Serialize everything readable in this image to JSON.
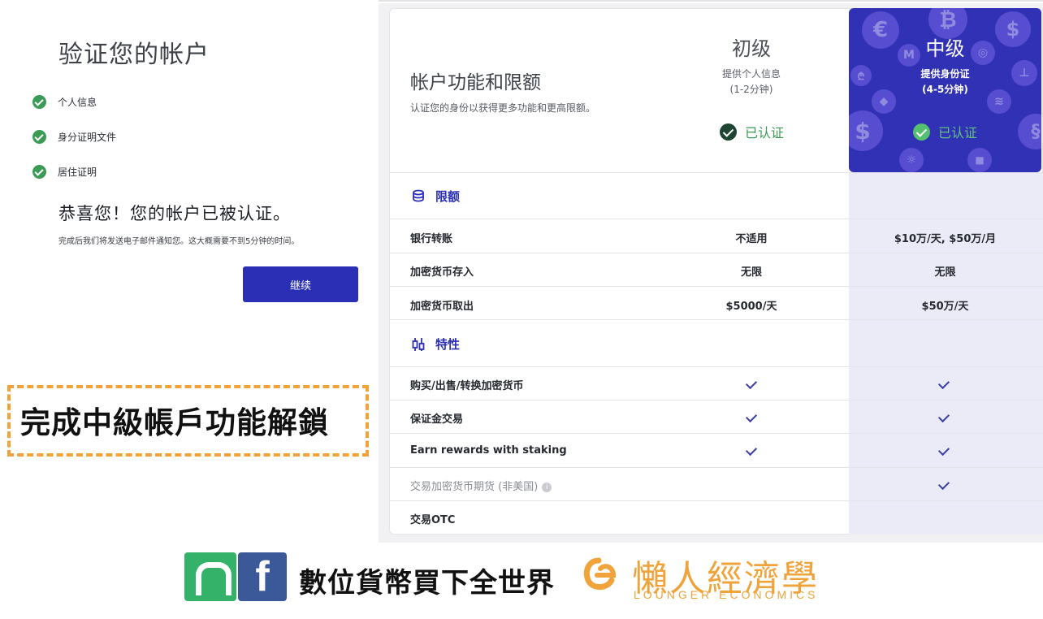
{
  "verify": {
    "title": "验证您的帐户",
    "steps": [
      "个人信息",
      "身分证明文件",
      "居住证明"
    ],
    "congrats": "恭喜您！您的帐户已被认证。",
    "notify": "完成后我们将发送电子邮件通知您。这大概需要不到5分钟的时间。",
    "continue_label": "继续"
  },
  "callout": {
    "text": "完成中級帳戶功能解鎖"
  },
  "table": {
    "title": "帐户功能和限额",
    "subtitle": "认证您的身份以获得更多功能和更高限额。",
    "levels": {
      "basic": {
        "name": "初级",
        "desc1": "提供个人信息",
        "desc2": "(1-2分钟)",
        "status": "已认证"
      },
      "intermediate": {
        "name": "中级",
        "desc1": "提供身份证",
        "desc2": "(4-5分钟)",
        "status": "已认证"
      }
    },
    "limits_section": "限额",
    "features_section": "特性",
    "limits": [
      {
        "label": "银行转账",
        "basic": "不适用",
        "intermediate": "$10万/天, $50万/月"
      },
      {
        "label": "加密货币存入",
        "basic": "无限",
        "intermediate": "无限"
      },
      {
        "label": "加密货币取出",
        "basic": "$5000/天",
        "intermediate": "$50万/天"
      }
    ],
    "features": [
      {
        "label": "购买/出售/转换加密货币",
        "basic": true,
        "intermediate": true,
        "muted": false
      },
      {
        "label": "保证金交易",
        "basic": true,
        "intermediate": true,
        "muted": false
      },
      {
        "label": "Earn rewards with staking",
        "basic": true,
        "intermediate": true,
        "muted": false
      },
      {
        "label": "交易加密货币期货 (非美国)",
        "basic": false,
        "intermediate": true,
        "muted": true
      },
      {
        "label": "交易OTC",
        "basic": false,
        "intermediate": false,
        "muted": false
      }
    ],
    "info_icon_glyph": "i"
  },
  "footer": {
    "f_glyph": "f",
    "slogan": "數位貨幣買下全世界",
    "brand_cn": "懶人經濟學",
    "brand_en": "LOUNGER ECONOMICS"
  },
  "colors": {
    "accent": "#2b2fb6",
    "verified_green": "#3a9b54",
    "callout_orange": "#f3a23a",
    "brand_orange": "#f0a33a"
  }
}
